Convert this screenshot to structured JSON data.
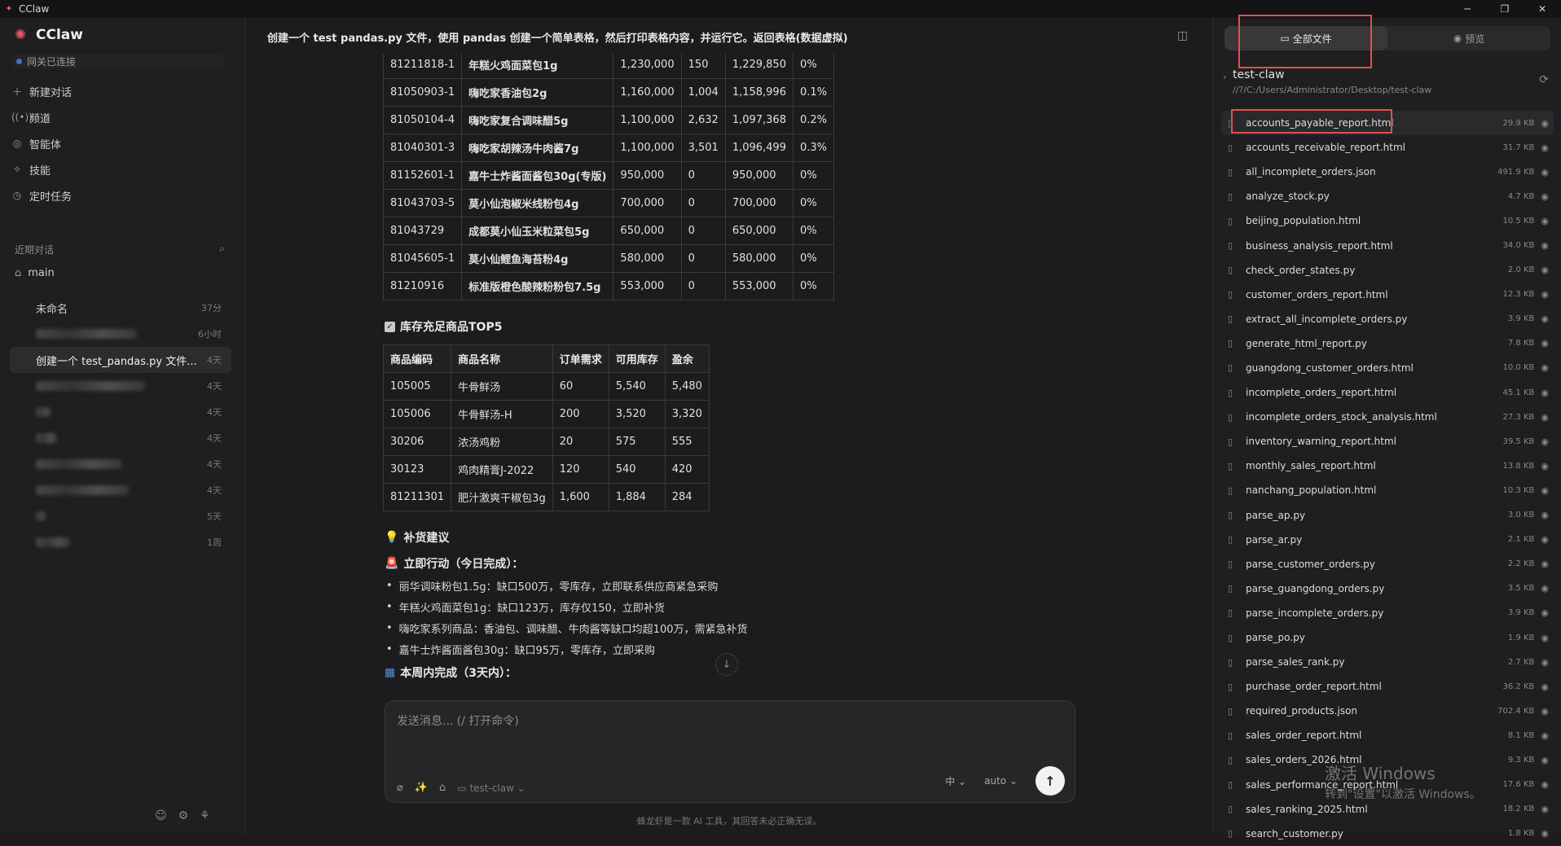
{
  "app": {
    "title": "CClaw",
    "name": "CClaw",
    "status": "网关已连接"
  },
  "nav": [
    "新建对话",
    "频道",
    "智能体",
    "技能",
    "定时任务"
  ],
  "recent": {
    "label": "近期对话",
    "workspace": "main",
    "items": [
      {
        "title": "未命名",
        "time": "37分",
        "blur": false
      },
      {
        "title": "",
        "time": "6小时",
        "blur": true,
        "w": 124
      },
      {
        "title": "创建一个 test_pandas.py 文件...",
        "time": "4天",
        "blur": false,
        "active": true
      },
      {
        "title": "",
        "time": "4天",
        "blur": true,
        "w": 134
      },
      {
        "title": "",
        "time": "4天",
        "blur": true,
        "w": 18
      },
      {
        "title": "",
        "time": "4天",
        "blur": true,
        "w": 26
      },
      {
        "title": "",
        "time": "4天",
        "blur": true,
        "w": 106
      },
      {
        "title": "",
        "time": "4天",
        "blur": true,
        "w": 114
      },
      {
        "title": "",
        "time": "5天",
        "blur": true,
        "w": 12
      },
      {
        "title": "",
        "time": "1周",
        "blur": true,
        "w": 42
      }
    ]
  },
  "chat": {
    "title": "创建一个 test pandas.py 文件，使用 pandas 创建一个简单表格，然后打印表格内容，并运行它。返回表格(数据虚拟)",
    "table1": [
      [
        "81211818-1",
        "年糕火鸡面菜包1g",
        "1,230,000",
        "150",
        "1,229,850",
        "0%"
      ],
      [
        "81050903-1",
        "嗨吃家香油包2g",
        "1,160,000",
        "1,004",
        "1,158,996",
        "0.1%"
      ],
      [
        "81050104-4",
        "嗨吃家复合调味醋5g",
        "1,100,000",
        "2,632",
        "1,097,368",
        "0.2%"
      ],
      [
        "81040301-3",
        "嗨吃家胡辣汤牛肉酱7g",
        "1,100,000",
        "3,501",
        "1,096,499",
        "0.3%"
      ],
      [
        "81152601-1",
        "嘉牛士炸酱面酱包30g(专版)",
        "950,000",
        "0",
        "950,000",
        "0%"
      ],
      [
        "81043703-5",
        "莫小仙泡椒米线粉包4g",
        "700,000",
        "0",
        "700,000",
        "0%"
      ],
      [
        "81043729",
        "成都莫小仙玉米粒菜包5g",
        "650,000",
        "0",
        "650,000",
        "0%"
      ],
      [
        "81045605-1",
        "莫小仙鲤鱼海苔粉4g",
        "580,000",
        "0",
        "580,000",
        "0%"
      ],
      [
        "81210916",
        "标准版橙色酸辣粉粉包7.5g",
        "553,000",
        "0",
        "553,000",
        "0%"
      ]
    ],
    "section2": "库存充足商品TOP5",
    "table2": {
      "headers": [
        "商品编码",
        "商品名称",
        "订单需求",
        "可用库存",
        "盈余"
      ],
      "rows": [
        [
          "105005",
          "牛骨鲜汤",
          "60",
          "5,540",
          "5,480"
        ],
        [
          "105006",
          "牛骨鲜汤-H",
          "200",
          "3,520",
          "3,320"
        ],
        [
          "30206",
          "浓汤鸡粉",
          "20",
          "575",
          "555"
        ],
        [
          "30123",
          "鸡肉精膏J-2022",
          "120",
          "540",
          "420"
        ],
        [
          "81211301",
          "肥汁激爽干椒包3g",
          "1,600",
          "1,884",
          "284"
        ]
      ]
    },
    "advice_title": "补货建议",
    "urgent_title": "立即行动（今日完成）：",
    "urgent": [
      "丽华调味粉包1.5g：缺口500万，零库存，立即联系供应商紧急采购",
      "年糕火鸡面菜包1g：缺口123万，库存仅150，立即补货",
      "嗨吃家系列商品：香油包、调味醋、牛肉酱等缺口均超100万，需紧急补货",
      "嘉牛士炸酱面酱包30g：缺口95万，零库存，立即采购"
    ],
    "week_title": "本周内完成（3天内）：",
    "input_placeholder": "发送消息... (/ 打开命令)",
    "project": "test-claw",
    "lang": "中",
    "mode": "auto",
    "disclaimer": "蜂龙虾是一款 AI 工具，其回答未必正确无误。"
  },
  "files": {
    "tab_all": "全部文件",
    "tab_preview": "预览",
    "folder": "test-claw",
    "path": "//?/C:/Users/Administrator/Desktop/test-claw",
    "items": [
      [
        "accounts_payable_report.html",
        "29.9 KB"
      ],
      [
        "accounts_receivable_report.html",
        "31.7 KB"
      ],
      [
        "all_incomplete_orders.json",
        "491.9 KB"
      ],
      [
        "analyze_stock.py",
        "4.7 KB"
      ],
      [
        "beijing_population.html",
        "10.5 KB"
      ],
      [
        "business_analysis_report.html",
        "34.0 KB"
      ],
      [
        "check_order_states.py",
        "2.0 KB"
      ],
      [
        "customer_orders_report.html",
        "12.3 KB"
      ],
      [
        "extract_all_incomplete_orders.py",
        "3.9 KB"
      ],
      [
        "generate_html_report.py",
        "7.8 KB"
      ],
      [
        "guangdong_customer_orders.html",
        "10.0 KB"
      ],
      [
        "incomplete_orders_report.html",
        "45.1 KB"
      ],
      [
        "incomplete_orders_stock_analysis.html",
        "27.3 KB"
      ],
      [
        "inventory_warning_report.html",
        "39.5 KB"
      ],
      [
        "monthly_sales_report.html",
        "13.8 KB"
      ],
      [
        "nanchang_population.html",
        "10.3 KB"
      ],
      [
        "parse_ap.py",
        "3.0 KB"
      ],
      [
        "parse_ar.py",
        "2.1 KB"
      ],
      [
        "parse_customer_orders.py",
        "2.2 KB"
      ],
      [
        "parse_guangdong_orders.py",
        "3.5 KB"
      ],
      [
        "parse_incomplete_orders.py",
        "3.9 KB"
      ],
      [
        "parse_po.py",
        "1.9 KB"
      ],
      [
        "parse_sales_rank.py",
        "2.7 KB"
      ],
      [
        "purchase_order_report.html",
        "36.2 KB"
      ],
      [
        "required_products.json",
        "702.4 KB"
      ],
      [
        "sales_order_report.html",
        "8.1 KB"
      ],
      [
        "sales_orders_2026.html",
        "9.3 KB"
      ],
      [
        "sales_performance_report.html",
        "17.6 KB"
      ],
      [
        "sales_ranking_2025.html",
        "18.2 KB"
      ],
      [
        "search_customer.py",
        "1.8 KB"
      ]
    ]
  },
  "watermark": {
    "line1": "激活 Windows",
    "line2": "转到\"设置\"以激活 Windows。"
  }
}
